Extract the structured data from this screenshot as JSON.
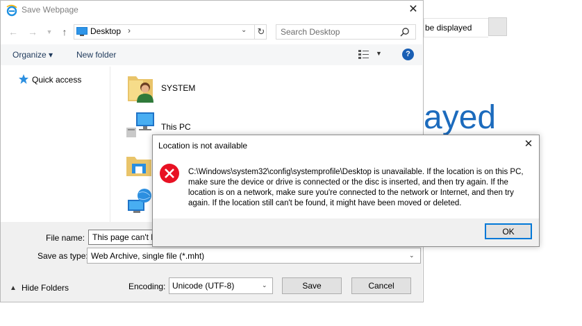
{
  "background_page": {
    "tab_text": "be displayed",
    "heading": "ayed",
    "accent_color": "#1c6bbd"
  },
  "save_dialog": {
    "title": "Save Webpage",
    "address": {
      "location": "Desktop",
      "search_placeholder": "Search Desktop"
    },
    "toolbar": {
      "organize_label": "Organize ▾",
      "new_folder_label": "New folder"
    },
    "nav_pane": {
      "items": [
        {
          "label": "Quick access",
          "icon": "star-icon"
        }
      ]
    },
    "files": [
      {
        "label": "SYSTEM",
        "icon": "user-folder-icon"
      },
      {
        "label": "This PC",
        "icon": "computer-icon"
      },
      {
        "label": "",
        "icon": "libraries-icon"
      },
      {
        "label": "",
        "icon": "network-icon"
      }
    ],
    "form": {
      "file_name_label": "File name:",
      "file_name_value": "This page can't b",
      "save_type_label": "Save as type:",
      "save_type_value": "Web Archive, single file (*.mht)",
      "encoding_label": "Encoding:",
      "encoding_value": "Unicode (UTF-8)",
      "hide_folders_label": "Hide Folders",
      "save_label": "Save",
      "cancel_label": "Cancel"
    }
  },
  "error_dialog": {
    "title": "Location is not available",
    "message": "C:\\Windows\\system32\\config\\systemprofile\\Desktop is unavailable. If the location is on this PC, make sure the device or drive is connected or the disc is inserted, and then try again. If the location is on a network, make sure you're connected to the network or Internet, and then try again. If the location still can't be found, it might have been moved or deleted.",
    "ok_label": "OK",
    "error_color": "#e81123"
  }
}
